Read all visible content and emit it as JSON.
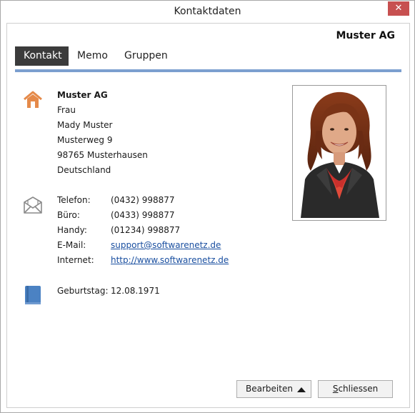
{
  "window": {
    "title": "Kontaktdaten",
    "close_label": "✕"
  },
  "header": {
    "company": "Muster AG"
  },
  "tabs": [
    {
      "label": "Kontakt"
    },
    {
      "label": "Memo"
    },
    {
      "label": "Gruppen"
    }
  ],
  "address": {
    "company": "Muster AG",
    "salutation": "Frau",
    "name": "Mady Muster",
    "street": "Musterweg 9",
    "city": "98765 Musterhausen",
    "country": "Deutschland"
  },
  "contact": {
    "telefon_label": "Telefon:",
    "telefon": "(0432) 998877",
    "buero_label": "Büro:",
    "buero": "(0433) 998877",
    "handy_label": "Handy:",
    "handy": "(01234) 998877",
    "email_label": "E-Mail:",
    "email": "support@softwarenetz.de",
    "internet_label": "Internet:",
    "internet": "http://www.softwarenetz.de"
  },
  "birthday": {
    "label": "Geburtstag:",
    "value": "12.08.1971"
  },
  "buttons": {
    "edit_label": "Bearbeiten",
    "close_prefix": "S",
    "close_rest": "chliessen"
  },
  "colors": {
    "accent_rule": "#7b9fcf",
    "home_icon": "#e58a4a",
    "book_icon": "#4b82c3",
    "active_tab": "#3b3b3b",
    "close_button": "#c75050"
  },
  "icons": [
    "home-icon",
    "envelope-icon",
    "book-icon",
    "caret-up-icon",
    "close-icon"
  ]
}
